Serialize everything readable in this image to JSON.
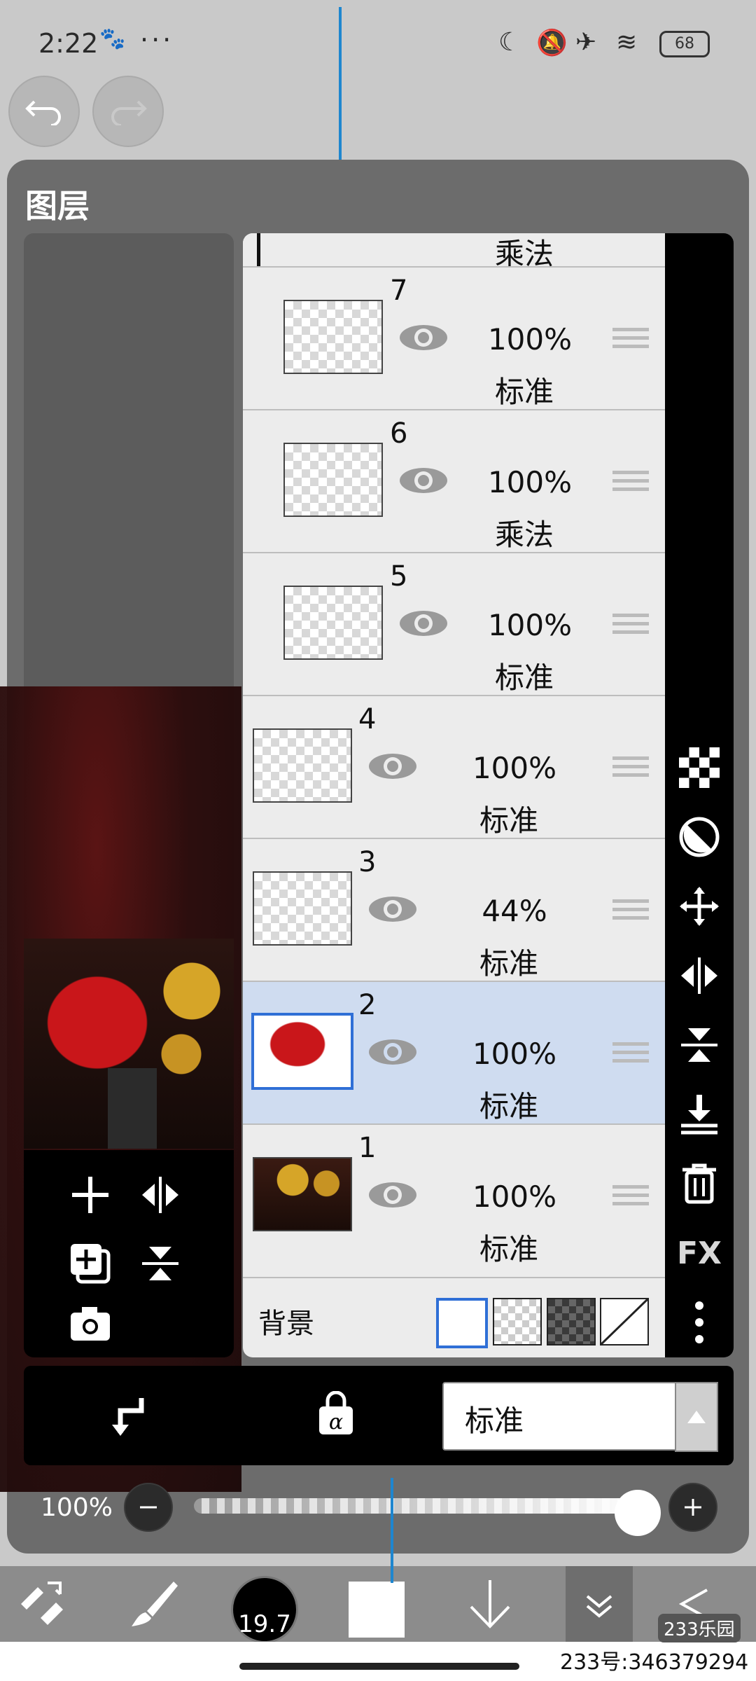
{
  "status_bar": {
    "time": "2:22",
    "more": "···",
    "battery": "68"
  },
  "panel": {
    "title": "图层"
  },
  "layers": [
    {
      "number": "7",
      "opacity": "100%",
      "blend": "标准"
    },
    {
      "number": "6",
      "opacity": "100%",
      "blend": "乘法"
    },
    {
      "number": "5",
      "opacity": "100%",
      "blend": "标准"
    },
    {
      "number": "4",
      "opacity": "100%",
      "blend": "标准"
    },
    {
      "number": "3",
      "opacity": "44%",
      "blend": "标准"
    },
    {
      "number": "2",
      "opacity": "100%",
      "blend": "标准",
      "selected": true
    },
    {
      "number": "1",
      "opacity": "100%",
      "blend": "标准"
    }
  ],
  "partial_layer_blend": "乘法",
  "background_row": {
    "label": "背景"
  },
  "right_tools": {
    "fx": "FX"
  },
  "blend_select": {
    "value": "标准"
  },
  "opacity": {
    "label": "100%",
    "value": 1.0
  },
  "brush": {
    "size": "19.7"
  },
  "watermark": {
    "text": "233号:346379294",
    "logo": "233乐园"
  },
  "colors": {
    "selection": "#cfdcf0",
    "accent": "#2f6fd6",
    "guide": "#1e86cf"
  }
}
